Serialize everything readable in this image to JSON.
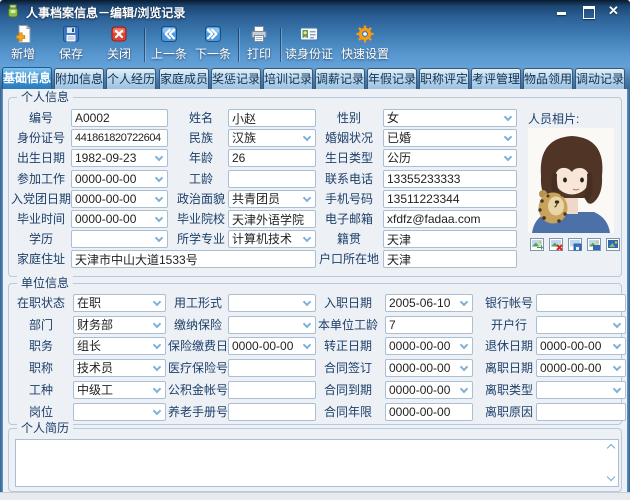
{
  "window": {
    "title": "人事档案信息－编辑/浏览记录"
  },
  "toolbar": {
    "items": [
      {
        "label": "新增"
      },
      {
        "label": "保存"
      },
      {
        "label": "关闭"
      },
      {
        "label": "上一条"
      },
      {
        "label": "下一条"
      },
      {
        "label": "打印"
      },
      {
        "label": "读身份证"
      },
      {
        "label": "快速设置"
      }
    ]
  },
  "tabs": [
    "基础信息",
    "附加信息",
    "个人经历",
    "家庭成员",
    "奖惩记录",
    "培训记录",
    "调薪记录",
    "年假记录",
    "职称评定",
    "考评管理",
    "物品领用",
    "调动记录"
  ],
  "photo": {
    "caption": "人员相片:"
  },
  "personal": {
    "legend": "个人信息",
    "code": {
      "label": "编号",
      "value": "A0002"
    },
    "name": {
      "label": "姓名",
      "value": "小赵"
    },
    "gender": {
      "label": "性别",
      "value": "女"
    },
    "id_number": {
      "label": "身份证号",
      "value": "441861820722604"
    },
    "ethnicity": {
      "label": "民族",
      "value": "汉族"
    },
    "marital_status": {
      "label": "婚姻状况",
      "value": "已婚"
    },
    "birth_date": {
      "label": "出生日期",
      "value": "1982-09-23"
    },
    "age": {
      "label": "年龄",
      "value": "26"
    },
    "birthday_type": {
      "label": "生日类型",
      "value": "公历"
    },
    "work_start_date": {
      "label": "参加工作",
      "value": "0000-00-00"
    },
    "seniority": {
      "label": "工龄",
      "value": ""
    },
    "phone": {
      "label": "联系电话",
      "value": "13355233333"
    },
    "party_join_date": {
      "label": "入党团日期",
      "value": "0000-00-00"
    },
    "political_status": {
      "label": "政治面貌",
      "value": "共青团员"
    },
    "mobile": {
      "label": "手机号码",
      "value": "13511223344"
    },
    "graduate_date": {
      "label": "毕业时间",
      "value": "0000-00-00"
    },
    "school": {
      "label": "毕业院校",
      "value": "天津外语学院"
    },
    "email": {
      "label": "电子邮箱",
      "value": "xfdfz@fadaa.com"
    },
    "education": {
      "label": "学历",
      "value": ""
    },
    "major": {
      "label": "所学专业",
      "value": "计算机技术"
    },
    "native_place": {
      "label": "籍贯",
      "value": "天津"
    },
    "home_address": {
      "label": "家庭住址",
      "value": "天津市中山大道1533号"
    },
    "household_location": {
      "label": "户口所在地",
      "value": "天津"
    }
  },
  "employment": {
    "legend": "单位信息",
    "employ_status": {
      "label": "在职状态",
      "value": "在职"
    },
    "employ_form": {
      "label": "用工形式",
      "value": ""
    },
    "hire_date": {
      "label": "入职日期",
      "value": "2005-06-10"
    },
    "bank_account": {
      "label": "银行帐号",
      "value": ""
    },
    "department": {
      "label": "部门",
      "value": "财务部"
    },
    "insurance_pay": {
      "label": "缴纳保险",
      "value": ""
    },
    "unit_seniority": {
      "label": "本单位工龄",
      "value": "7"
    },
    "bank_name": {
      "label": "开户行",
      "value": ""
    },
    "duty": {
      "label": "职务",
      "value": "组长"
    },
    "insurance_pay_date": {
      "label": "保险缴费日",
      "value": "0000-00-00"
    },
    "regular_date": {
      "label": "转正日期",
      "value": "0000-00-00"
    },
    "retire_date": {
      "label": "退休日期",
      "value": "0000-00-00"
    },
    "title": {
      "label": "职称",
      "value": "技术员"
    },
    "medical_insurance_no": {
      "label": "医疗保险号",
      "value": ""
    },
    "contract_sign_date": {
      "label": "合同签订",
      "value": "0000-00-00"
    },
    "leave_date": {
      "label": "离职日期",
      "value": "0000-00-00"
    },
    "worker_type": {
      "label": "工种",
      "value": "中级工"
    },
    "housing_fund_no": {
      "label": "公积金帐号",
      "value": ""
    },
    "contract_expire_date": {
      "label": "合同到期",
      "value": "0000-00-00"
    },
    "leave_type": {
      "label": "离职类型",
      "value": ""
    },
    "post": {
      "label": "岗位",
      "value": ""
    },
    "pension_book_no": {
      "label": "养老手册号",
      "value": ""
    },
    "contract_years": {
      "label": "合同年限",
      "value": "0000-00-00"
    },
    "leave_reason": {
      "label": "离职原因",
      "value": ""
    }
  },
  "resume": {
    "legend": "个人简历",
    "value": ""
  }
}
